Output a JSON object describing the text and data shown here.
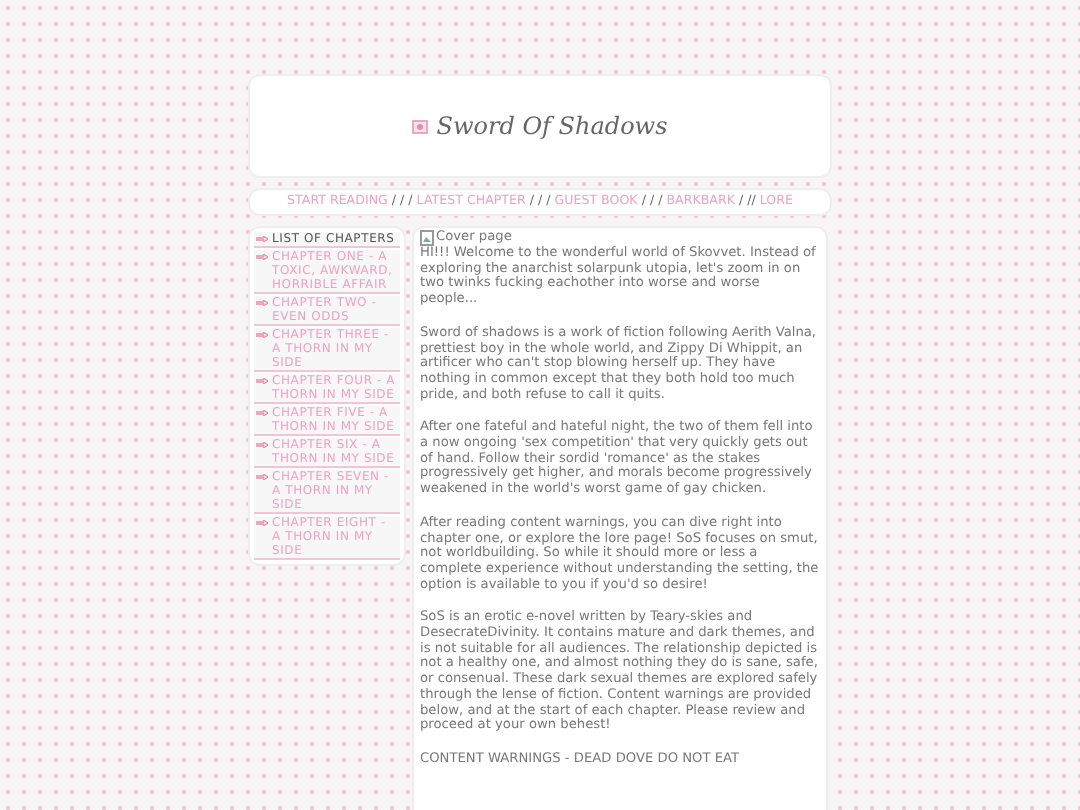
{
  "header": {
    "title": "Sword Of Shadows"
  },
  "nav": [
    {
      "label": "START READING",
      "sep": "/ / /"
    },
    {
      "label": "LATEST CHAPTER",
      "sep": "/ / /"
    },
    {
      "label": "GUEST BOOK",
      "sep": "/ / /"
    },
    {
      "label": "BARKBARK",
      "sep": "/ //"
    },
    {
      "label": "LORE"
    }
  ],
  "sidebar": {
    "heading": "LIST OF CHAPTERS",
    "items": [
      "CHAPTER ONE - A TOXIC, AWKWARD, HORRIBLE AFFAIR",
      "CHAPTER TWO - EVEN ODDS",
      "CHAPTER THREE - A THORN IN MY SIDE",
      "CHAPTER FOUR - A THORN IN MY SIDE",
      "CHAPTER FIVE - A THORN IN MY SIDE",
      "CHAPTER SIX - A THORN IN MY SIDE",
      "CHAPTER SEVEN - A THORN IN MY SIDE",
      "CHAPTER EIGHT - A THORN IN MY SIDE"
    ]
  },
  "content": {
    "image_alt": "Cover page",
    "paragraphs": [
      "HI!!! Welcome to the wonderful world of Skovvet. Instead of exploring the anarchist solarpunk utopia, let's zoom in on two twinks fucking eachother into worse and worse people...",
      "Sword of shadows is a work of fiction following Aerith Valna, prettiest boy in the whole world, and Zippy Di Whippit, an artificer who can't stop blowing herself up. They have nothing in common except that they both hold too much pride, and both refuse to call it quits.",
      "After one fateful and hateful night, the two of them fell into a now ongoing 'sex competition' that very quickly gets out of hand. Follow their sordid 'romance' as the stakes progressively get higher, and morals become progressively weakened in the world's worst game of gay chicken.",
      "After reading content warnings, you can dive right into chapter one, or explore the lore page! SoS focuses on smut, not worldbuilding. So while it should more or less a complete experience without understanding the setting, the option is available to you if you'd so desire!",
      "SoS is an erotic e-novel written by Teary-skies and DesecrateDivinity. It contains mature and dark themes, and is not suitable for all audiences. The relationship depicted is not a healthy one, and almost nothing they do is sane, safe, or consenual. These dark sexual themes are explored safely through the lense of fiction. Content warnings are provided below, and at the start of each chapter. Please review and proceed at your own behest!",
      "CONTENT WARNINGS - DEAD DOVE DO NOT EAT"
    ]
  }
}
